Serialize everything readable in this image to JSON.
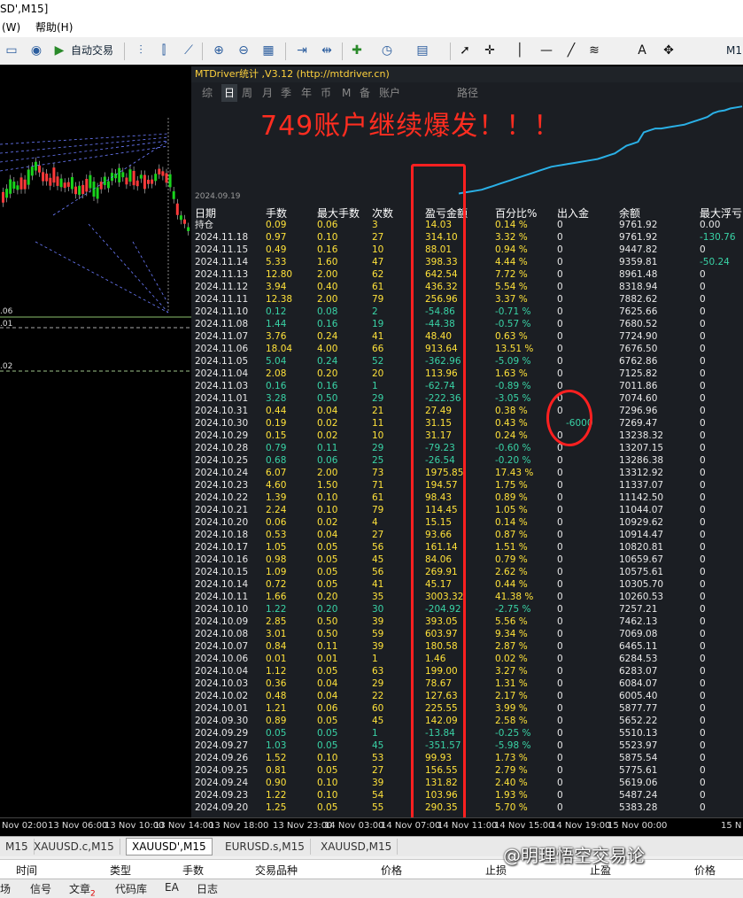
{
  "window": {
    "title": "SD',M15]"
  },
  "menu": [
    {
      "label": "(W)"
    },
    {
      "label": "帮助(H)"
    }
  ],
  "toolbar": {
    "autotrade_label": "自动交易",
    "right_label": "M1"
  },
  "stats_panel": {
    "title": "MTDriver统计 ,V3.12 (http://mtdriver.cn)",
    "tabs": [
      "综",
      "日",
      "周",
      "月",
      "季",
      "年",
      "币",
      "M",
      "备",
      "账户",
      "路径"
    ],
    "active_tab": "日",
    "headline": "749账户继续爆发！！！",
    "equity_start_date": "2024.09.19",
    "equity_curve": [
      0.06,
      0.07,
      0.08,
      0.09,
      0.1,
      0.12,
      0.14,
      0.16,
      0.18,
      0.2,
      0.22,
      0.24,
      0.26,
      0.28,
      0.3,
      0.32,
      0.34,
      0.35,
      0.36,
      0.37,
      0.38,
      0.39,
      0.4,
      0.41,
      0.42,
      0.44,
      0.46,
      0.48,
      0.52,
      0.56,
      0.58,
      0.6,
      0.7,
      0.72,
      0.74,
      0.74,
      0.75,
      0.76,
      0.77,
      0.78,
      0.8,
      0.82,
      0.84,
      0.86,
      0.9,
      0.92,
      0.93,
      0.95,
      0.96,
      0.97
    ],
    "columns": [
      "日期",
      "手数",
      "最大手数",
      "次数",
      "盈亏金额",
      "百分比%",
      "出入金",
      "余额",
      "最大浮亏"
    ],
    "rows": [
      [
        "持仓",
        "0.09",
        "0.06",
        "3",
        "14.03",
        "0.14 %",
        "0",
        "9761.92",
        "0.00"
      ],
      [
        "2024.11.18",
        "0.97",
        "0.10",
        "27",
        "314.10",
        "3.32 %",
        "0",
        "9761.92",
        "-130.76"
      ],
      [
        "2024.11.15",
        "0.49",
        "0.16",
        "10",
        "88.01",
        "0.94 %",
        "0",
        "9447.82",
        "0"
      ],
      [
        "2024.11.14",
        "5.33",
        "1.60",
        "47",
        "398.33",
        "4.44 %",
        "0",
        "9359.81",
        "-50.24"
      ],
      [
        "2024.11.13",
        "12.80",
        "2.00",
        "62",
        "642.54",
        "7.72 %",
        "0",
        "8961.48",
        "0"
      ],
      [
        "2024.11.12",
        "3.94",
        "0.40",
        "61",
        "436.32",
        "5.54 %",
        "0",
        "8318.94",
        "0"
      ],
      [
        "2024.11.11",
        "12.38",
        "2.00",
        "79",
        "256.96",
        "3.37 %",
        "0",
        "7882.62",
        "0"
      ],
      [
        "2024.11.10",
        "0.12",
        "0.08",
        "2",
        "-54.86",
        "-0.71 %",
        "0",
        "7625.66",
        "0"
      ],
      [
        "2024.11.08",
        "1.44",
        "0.16",
        "19",
        "-44.38",
        "-0.57 %",
        "0",
        "7680.52",
        "0"
      ],
      [
        "2024.11.07",
        "3.76",
        "0.24",
        "41",
        "48.40",
        "0.63 %",
        "0",
        "7724.90",
        "0"
      ],
      [
        "2024.11.06",
        "18.04",
        "4.00",
        "66",
        "913.64",
        "13.51 %",
        "0",
        "7676.50",
        "0"
      ],
      [
        "2024.11.05",
        "5.04",
        "0.24",
        "52",
        "-362.96",
        "-5.09 %",
        "0",
        "6762.86",
        "0"
      ],
      [
        "2024.11.04",
        "2.08",
        "0.20",
        "20",
        "113.96",
        "1.63 %",
        "0",
        "7125.82",
        "0"
      ],
      [
        "2024.11.03",
        "0.16",
        "0.16",
        "1",
        "-62.74",
        "-0.89 %",
        "0",
        "7011.86",
        "0"
      ],
      [
        "2024.11.01",
        "3.28",
        "0.50",
        "29",
        "-222.36",
        "-3.05 %",
        "0",
        "7074.60",
        "0"
      ],
      [
        "2024.10.31",
        "0.44",
        "0.04",
        "21",
        "27.49",
        "0.38 %",
        "0",
        "7296.96",
        "0"
      ],
      [
        "2024.10.30",
        "0.19",
        "0.02",
        "11",
        "31.15",
        "0.43 %",
        "-6000",
        "7269.47",
        "0"
      ],
      [
        "2024.10.29",
        "0.15",
        "0.02",
        "10",
        "31.17",
        "0.24 %",
        "0",
        "13238.32",
        "0"
      ],
      [
        "2024.10.28",
        "0.79",
        "0.11",
        "29",
        "-79.23",
        "-0.60 %",
        "0",
        "13207.15",
        "0"
      ],
      [
        "2024.10.25",
        "0.68",
        "0.06",
        "25",
        "-26.54",
        "-0.20 %",
        "0",
        "13286.38",
        "0"
      ],
      [
        "2024.10.24",
        "6.07",
        "2.00",
        "73",
        "1975.85",
        "17.43 %",
        "0",
        "13312.92",
        "0"
      ],
      [
        "2024.10.23",
        "4.60",
        "1.50",
        "71",
        "194.57",
        "1.75 %",
        "0",
        "11337.07",
        "0"
      ],
      [
        "2024.10.22",
        "1.39",
        "0.10",
        "61",
        "98.43",
        "0.89 %",
        "0",
        "11142.50",
        "0"
      ],
      [
        "2024.10.21",
        "2.24",
        "0.10",
        "79",
        "114.45",
        "1.05 %",
        "0",
        "11044.07",
        "0"
      ],
      [
        "2024.10.20",
        "0.06",
        "0.02",
        "4",
        "15.15",
        "0.14 %",
        "0",
        "10929.62",
        "0"
      ],
      [
        "2024.10.18",
        "0.53",
        "0.04",
        "27",
        "93.66",
        "0.87 %",
        "0",
        "10914.47",
        "0"
      ],
      [
        "2024.10.17",
        "1.05",
        "0.05",
        "56",
        "161.14",
        "1.51 %",
        "0",
        "10820.81",
        "0"
      ],
      [
        "2024.10.16",
        "0.98",
        "0.05",
        "45",
        "84.06",
        "0.79 %",
        "0",
        "10659.67",
        "0"
      ],
      [
        "2024.10.15",
        "1.09",
        "0.05",
        "56",
        "269.91",
        "2.62 %",
        "0",
        "10575.61",
        "0"
      ],
      [
        "2024.10.14",
        "0.72",
        "0.05",
        "41",
        "45.17",
        "0.44 %",
        "0",
        "10305.70",
        "0"
      ],
      [
        "2024.10.11",
        "1.66",
        "0.20",
        "35",
        "3003.32",
        "41.38 %",
        "0",
        "10260.53",
        "0"
      ],
      [
        "2024.10.10",
        "1.22",
        "0.20",
        "30",
        "-204.92",
        "-2.75 %",
        "0",
        "7257.21",
        "0"
      ],
      [
        "2024.10.09",
        "2.85",
        "0.50",
        "39",
        "393.05",
        "5.56 %",
        "0",
        "7462.13",
        "0"
      ],
      [
        "2024.10.08",
        "3.01",
        "0.50",
        "59",
        "603.97",
        "9.34 %",
        "0",
        "7069.08",
        "0"
      ],
      [
        "2024.10.07",
        "0.84",
        "0.11",
        "39",
        "180.58",
        "2.87 %",
        "0",
        "6465.11",
        "0"
      ],
      [
        "2024.10.06",
        "0.01",
        "0.01",
        "1",
        "1.46",
        "0.02 %",
        "0",
        "6284.53",
        "0"
      ],
      [
        "2024.10.04",
        "1.12",
        "0.05",
        "63",
        "199.00",
        "3.27 %",
        "0",
        "6283.07",
        "0"
      ],
      [
        "2024.10.03",
        "0.36",
        "0.04",
        "29",
        "78.67",
        "1.31 %",
        "0",
        "6084.07",
        "0"
      ],
      [
        "2024.10.02",
        "0.48",
        "0.04",
        "22",
        "127.63",
        "2.17 %",
        "0",
        "6005.40",
        "0"
      ],
      [
        "2024.10.01",
        "1.21",
        "0.06",
        "60",
        "225.55",
        "3.99 %",
        "0",
        "5877.77",
        "0"
      ],
      [
        "2024.09.30",
        "0.89",
        "0.05",
        "45",
        "142.09",
        "2.58 %",
        "0",
        "5652.22",
        "0"
      ],
      [
        "2024.09.29",
        "0.05",
        "0.05",
        "1",
        "-13.84",
        "-0.25 %",
        "0",
        "5510.13",
        "0"
      ],
      [
        "2024.09.27",
        "1.03",
        "0.05",
        "45",
        "-351.57",
        "-5.98 %",
        "0",
        "5523.97",
        "0"
      ],
      [
        "2024.09.26",
        "1.52",
        "0.10",
        "53",
        "99.93",
        "1.73 %",
        "0",
        "5875.54",
        "0"
      ],
      [
        "2024.09.25",
        "0.81",
        "0.05",
        "27",
        "156.55",
        "2.79 %",
        "0",
        "5775.61",
        "0"
      ],
      [
        "2024.09.24",
        "0.90",
        "0.10",
        "39",
        "131.82",
        "2.40 %",
        "0",
        "5619.06",
        "0"
      ],
      [
        "2024.09.23",
        "1.22",
        "0.10",
        "54",
        "103.96",
        "1.93 %",
        "0",
        "5487.24",
        "0"
      ],
      [
        "2024.09.20",
        "1.25",
        "0.05",
        "55",
        "290.35",
        "5.70 %",
        "0",
        "5383.28",
        "0"
      ]
    ]
  },
  "chart": {
    "price_labels": [
      ".06",
      ".01",
      ".02"
    ],
    "time_labels": [
      "Nov 02:00",
      "13 Nov 06:00",
      "13 Nov 10:00",
      "13 Nov 14:00",
      "13 Nov 18:00",
      "13 Nov 23:00",
      "14 Nov 03:00",
      "14 Nov 07:00",
      "14 Nov 11:00",
      "14 Nov 15:00",
      "14 Nov 19:00",
      "15 Nov 00:00",
      "15 N"
    ]
  },
  "symbol_tabs": [
    {
      "label": "M15",
      "active": false
    },
    {
      "label": "XAUUSD.c,M15",
      "active": false
    },
    {
      "label": "XAUUSD',M15",
      "active": true
    },
    {
      "label": "EURUSD.s,M15",
      "active": false
    },
    {
      "label": "XAUUSD,M15",
      "active": false
    }
  ],
  "terminal_columns": [
    "时间",
    "类型",
    "手数",
    "交易品种",
    "价格",
    "止损",
    "止盈",
    "价格"
  ],
  "bottom_tabs": [
    "场",
    "信号",
    "文章",
    "代码库",
    "EA",
    "日志"
  ],
  "article_badge": "2",
  "watermark": "@明理悟空交易论"
}
